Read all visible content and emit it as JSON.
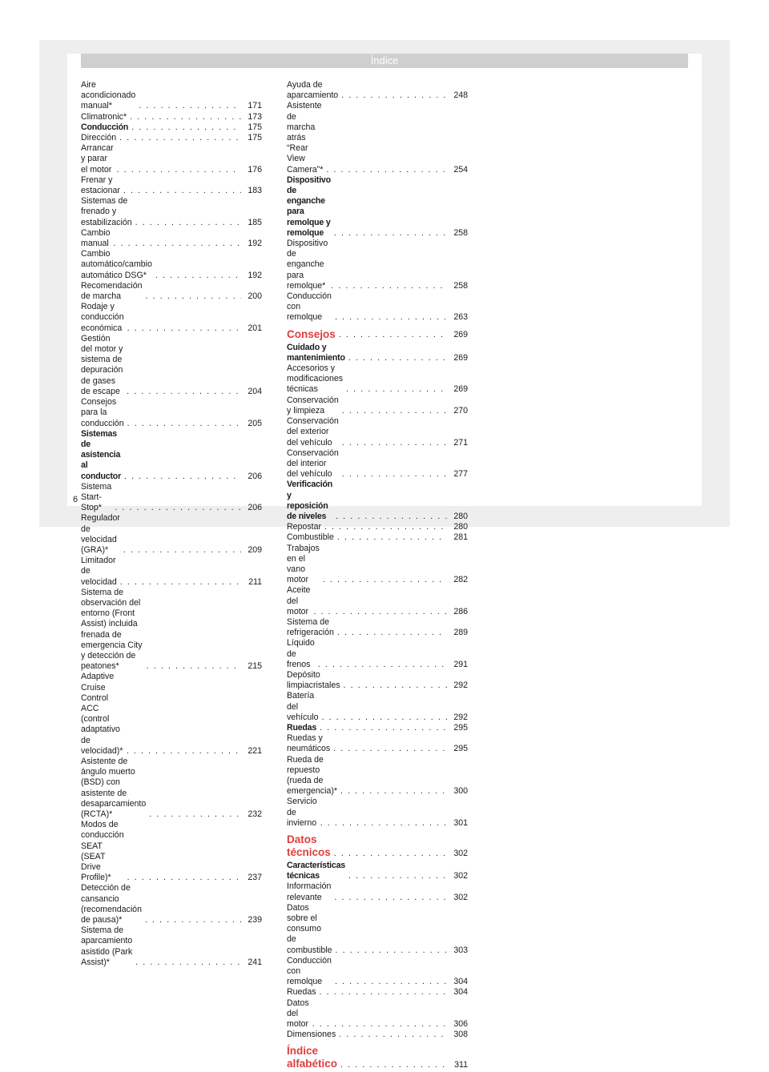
{
  "header": {
    "title": "Índice"
  },
  "left_column": [
    {
      "text": "Aire acondicionado manual*",
      "page": "171"
    },
    {
      "text": "Climatronic*",
      "page": "173"
    },
    {
      "text": "Conducción",
      "page": "175",
      "style": "bold"
    },
    {
      "text": "Dirección",
      "page": "175"
    },
    {
      "text": "Arrancar y parar el motor",
      "page": "176"
    },
    {
      "text": "Frenar y estacionar",
      "page": "183"
    },
    {
      "text": "Sistemas de frenado y estabilización",
      "page": "185"
    },
    {
      "text": "Cambio manual",
      "page": "192"
    },
    {
      "text": "Cambio automático/cambio automático DSG*",
      "page": "192"
    },
    {
      "text": "Recomendación de marcha",
      "page": "200"
    },
    {
      "text": "Rodaje y conducción económica",
      "page": "201"
    },
    {
      "text": "Gestión del motor y sistema de depuración de gases de escape",
      "page": "204"
    },
    {
      "text": "Consejos para la conducción",
      "page": "205"
    },
    {
      "text": "Sistemas de asistencia al conductor",
      "page": "206",
      "style": "bold"
    },
    {
      "text": "Sistema Start-Stop*",
      "page": "206"
    },
    {
      "text": "Regulador de velocidad (GRA)*",
      "page": "209"
    },
    {
      "text": "Limitador de velocidad",
      "page": "211"
    },
    {
      "text": "Sistema de observación del entorno (Front Assist) incluida frenada de emergencia City y detección de peatones*",
      "page": "215"
    },
    {
      "text": "Adaptive Cruise Control ACC (control adaptativo de velocidad)*",
      "page": "221"
    },
    {
      "text": "Asistente de ángulo muerto (BSD) con asistente de desaparcamiento (RCTA)*",
      "page": "232"
    },
    {
      "text": "Modos de conducción SEAT (SEAT Drive Profile)*",
      "page": "237"
    },
    {
      "text": "Detección de cansancio (recomendación de pausa)*",
      "page": "239"
    },
    {
      "text": "Sistema de aparcamiento asistido (Park Assist)*",
      "page": "241"
    }
  ],
  "right_column": [
    {
      "text": "Ayuda de aparcamiento",
      "page": "248"
    },
    {
      "text": "Asistente de marcha atrás “Rear View Camera”*",
      "page": "254"
    },
    {
      "text": "Dispositivo de enganche para remolque y remolque",
      "page": "258",
      "style": "bold"
    },
    {
      "text": "Dispositivo de enganche para remolque*",
      "page": "258"
    },
    {
      "text": "Conducción con remolque",
      "page": "263"
    },
    {
      "text": "Consejos",
      "page": "269",
      "style": "section"
    },
    {
      "text": "Cuidado y mantenimiento",
      "page": "269",
      "style": "bold"
    },
    {
      "text": "Accesorios y modificaciones técnicas",
      "page": "269"
    },
    {
      "text": "Conservación y limpieza",
      "page": "270"
    },
    {
      "text": "Conservación del exterior del vehículo",
      "page": "271"
    },
    {
      "text": "Conservación del interior del vehículo",
      "page": "277"
    },
    {
      "text": "Verificación y reposición de niveles",
      "page": "280",
      "style": "bold"
    },
    {
      "text": "Repostar",
      "page": "280"
    },
    {
      "text": "Combustible",
      "page": "281"
    },
    {
      "text": "Trabajos en el vano motor",
      "page": "282"
    },
    {
      "text": "Aceite del motor",
      "page": "286"
    },
    {
      "text": "Sistema de refrigeración",
      "page": "289"
    },
    {
      "text": "Líquido de frenos",
      "page": "291"
    },
    {
      "text": "Depósito limpiacristales",
      "page": "292"
    },
    {
      "text": "Batería del vehículo",
      "page": "292"
    },
    {
      "text": "Ruedas",
      "page": "295",
      "style": "bold"
    },
    {
      "text": "Ruedas y neumáticos",
      "page": "295"
    },
    {
      "text": "Rueda de repuesto (rueda de emergencia)*",
      "page": "300"
    },
    {
      "text": "Servicio de invierno",
      "page": "301"
    },
    {
      "text": "Datos técnicos",
      "page": "302",
      "style": "section"
    },
    {
      "text": "Características técnicas",
      "page": "302",
      "style": "bold"
    },
    {
      "text": "Información relevante",
      "page": "302"
    },
    {
      "text": "Datos sobre el consumo de combustible",
      "page": "303"
    },
    {
      "text": "Conducción con remolque",
      "page": "304"
    },
    {
      "text": "Ruedas",
      "page": "304"
    },
    {
      "text": "Datos del motor",
      "page": "306"
    },
    {
      "text": "Dimensiones",
      "page": "308"
    },
    {
      "text": "Índice alfabético",
      "page": "311",
      "style": "section"
    }
  ],
  "footer": {
    "page_number": "6"
  },
  "colors": {
    "section_heading": "#e03c3c",
    "header_bar": "#cfcfcf",
    "sheet_background": "#eeeeee"
  }
}
